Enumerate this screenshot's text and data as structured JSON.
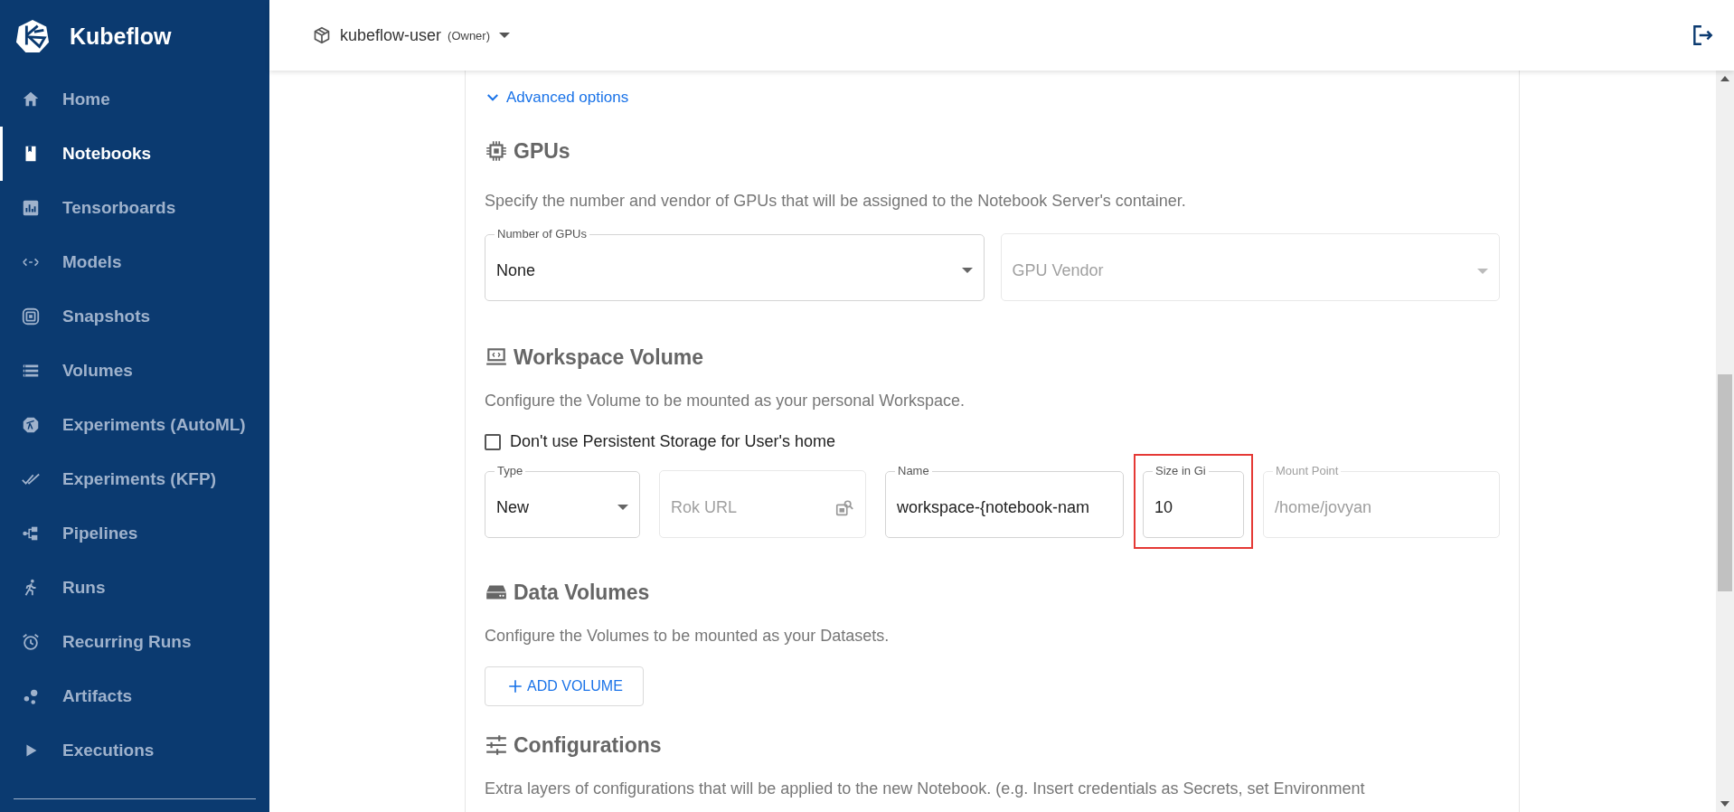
{
  "sidebar": {
    "logo_text": "Kubeflow",
    "items": [
      {
        "label": "Home",
        "selected": false
      },
      {
        "label": "Notebooks",
        "selected": true
      },
      {
        "label": "Tensorboards",
        "selected": false
      },
      {
        "label": "Models",
        "selected": false
      },
      {
        "label": "Snapshots",
        "selected": false
      },
      {
        "label": "Volumes",
        "selected": false
      },
      {
        "label": "Experiments (AutoML)",
        "selected": false
      },
      {
        "label": "Experiments (KFP)",
        "selected": false
      },
      {
        "label": "Pipelines",
        "selected": false
      },
      {
        "label": "Runs",
        "selected": false
      },
      {
        "label": "Recurring Runs",
        "selected": false
      },
      {
        "label": "Artifacts",
        "selected": false
      },
      {
        "label": "Executions",
        "selected": false
      }
    ]
  },
  "top_bar": {
    "namespace": "kubeflow-user",
    "role": "(Owner)"
  },
  "advanced_options": {
    "label": "Advanced options",
    "expanded": true
  },
  "gpus": {
    "title": "GPUs",
    "description": "Specify the number and vendor of GPUs that will be assigned to the Notebook Server's container.",
    "fields": [
      {
        "kind": "select",
        "label": "Number of GPUs",
        "value": "None",
        "disabled": false,
        "highlighted": false
      },
      {
        "kind": "select",
        "placeholder": "GPU Vendor",
        "disabled": true,
        "highlighted": false
      }
    ]
  },
  "workspace_volume": {
    "title": "Workspace Volume",
    "description": "Configure the Volume to be mounted as your personal Workspace.",
    "checkbox": {
      "label": "Don't use Persistent Storage for User's home",
      "checked": false
    },
    "fields": [
      {
        "kind": "select",
        "label": "Type",
        "value": "New",
        "disabled": false,
        "highlighted": false
      },
      {
        "kind": "search",
        "placeholder": "Rok URL",
        "disabled": true,
        "highlighted": false
      },
      {
        "kind": "input",
        "label": "Name",
        "value": "workspace-{notebook-nam",
        "disabled": false,
        "highlighted": false
      },
      {
        "kind": "input",
        "label": "Size in Gi",
        "value": "10",
        "disabled": false,
        "highlighted": true
      },
      {
        "kind": "input",
        "label": "Mount Point",
        "value": "/home/jovyan",
        "disabled": true,
        "highlighted": false
      }
    ]
  },
  "data_volumes": {
    "title": "Data Volumes",
    "description": "Configure the Volumes to be mounted as your Datasets.",
    "button": "ADD VOLUME"
  },
  "configurations": {
    "title": "Configurations",
    "description": "Extra layers of configurations that will be applied to the new Notebook. (e.g. Insert credentials as Secrets, set Environment"
  }
}
